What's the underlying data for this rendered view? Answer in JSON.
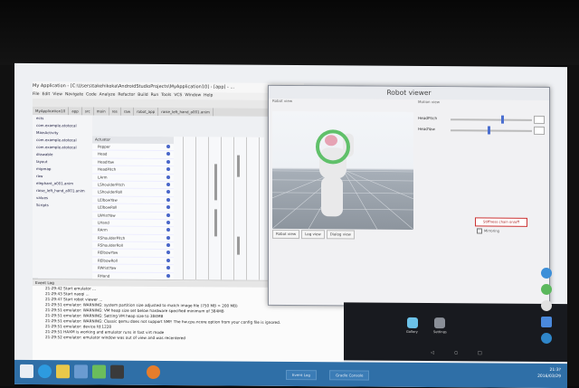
{
  "ide": {
    "title": "My Application - [C:\\Users\\takehikoka\\AndroidStudioProjects\\MyApplication10] - [app] - ...",
    "menu": [
      "File",
      "Edit",
      "View",
      "Navigate",
      "Code",
      "Analyze",
      "Refactor",
      "Build",
      "Run",
      "Tools",
      "VCS",
      "Window",
      "Help"
    ],
    "tabs": [
      "MyApplication10",
      "app",
      "src",
      "main",
      "res",
      "raw",
      "robot_app",
      "raise_left_hand_a001.anim"
    ],
    "project_items": [
      "ects",
      "com.example.atotecal",
      "MainActivity",
      "com.example.atotecal",
      "com.example.atotecal",
      "drawable",
      "layout",
      "mipmap",
      "raw",
      "elephant_a001.anim",
      "raise_left_hand_a001.anim",
      "values",
      "Scripts"
    ],
    "actuator_header": "Actuator",
    "actuators": [
      "Pepper",
      "Head",
      "HeadYaw",
      "HeadPitch",
      "LArm",
      "LShoulderPitch",
      "LShoulderRoll",
      "LElbowYaw",
      "LElbowRoll",
      "LWristYaw",
      "LHand",
      "RArm",
      "RShoulderPitch",
      "RShoulderRoll",
      "RElbowYaw",
      "RElbowRoll",
      "RWristYaw",
      "RHand",
      "Leg",
      "HipRoll"
    ]
  },
  "log": {
    "header": "Event Log",
    "lines": [
      "21:29:42 Start emulator ...",
      "21:29:43 Start naoqi ...",
      "21:29:47 Start robot viewer ...",
      "21:29:51 emulator: WARNING: system partition size adjusted to match image file (750 MB > 200 MB)",
      "21:29:51 emulator: WARNING: VM heap size set below hardware specified minimum of 384MB",
      "21:29:51 emulator: WARNING: Setting VM heap size to 384MB",
      "21:29:51 emulator: WARNING: Classic qemu does not support SMP. The hw.cpu.ncore option from your config file is ignored.",
      "21:29:51 emulator: device fd:1228",
      "21:29:51 HAXM is working and emulator runs in fast virt mode",
      "21:29:52 emulator: emulator window was out of view and was recentered"
    ]
  },
  "robot_viewer": {
    "title": "Robot viewer",
    "subtitle": "Robot view",
    "motion_label": "Motion view",
    "sliders": [
      {
        "label": "HeadPitch",
        "value": 0.62
      },
      {
        "label": "HeadYaw",
        "value": 0.45
      }
    ],
    "view_tabs": [
      "Robot view",
      "Log view",
      "Dialog view"
    ],
    "stiffness_button": "Stiffness chain on/off",
    "mirroring": "Mirroring"
  },
  "emulator": {
    "apps": [
      {
        "name": "Gallery",
        "color": "#6cc2e8"
      },
      {
        "name": "Settings",
        "color": "#8a8f98"
      }
    ],
    "nav": [
      "◁",
      "○",
      "□"
    ]
  },
  "taskbar": {
    "buttons": [
      "Event Log",
      "Gradle Console"
    ],
    "time": "21:3?",
    "date": "2016/03/29"
  }
}
